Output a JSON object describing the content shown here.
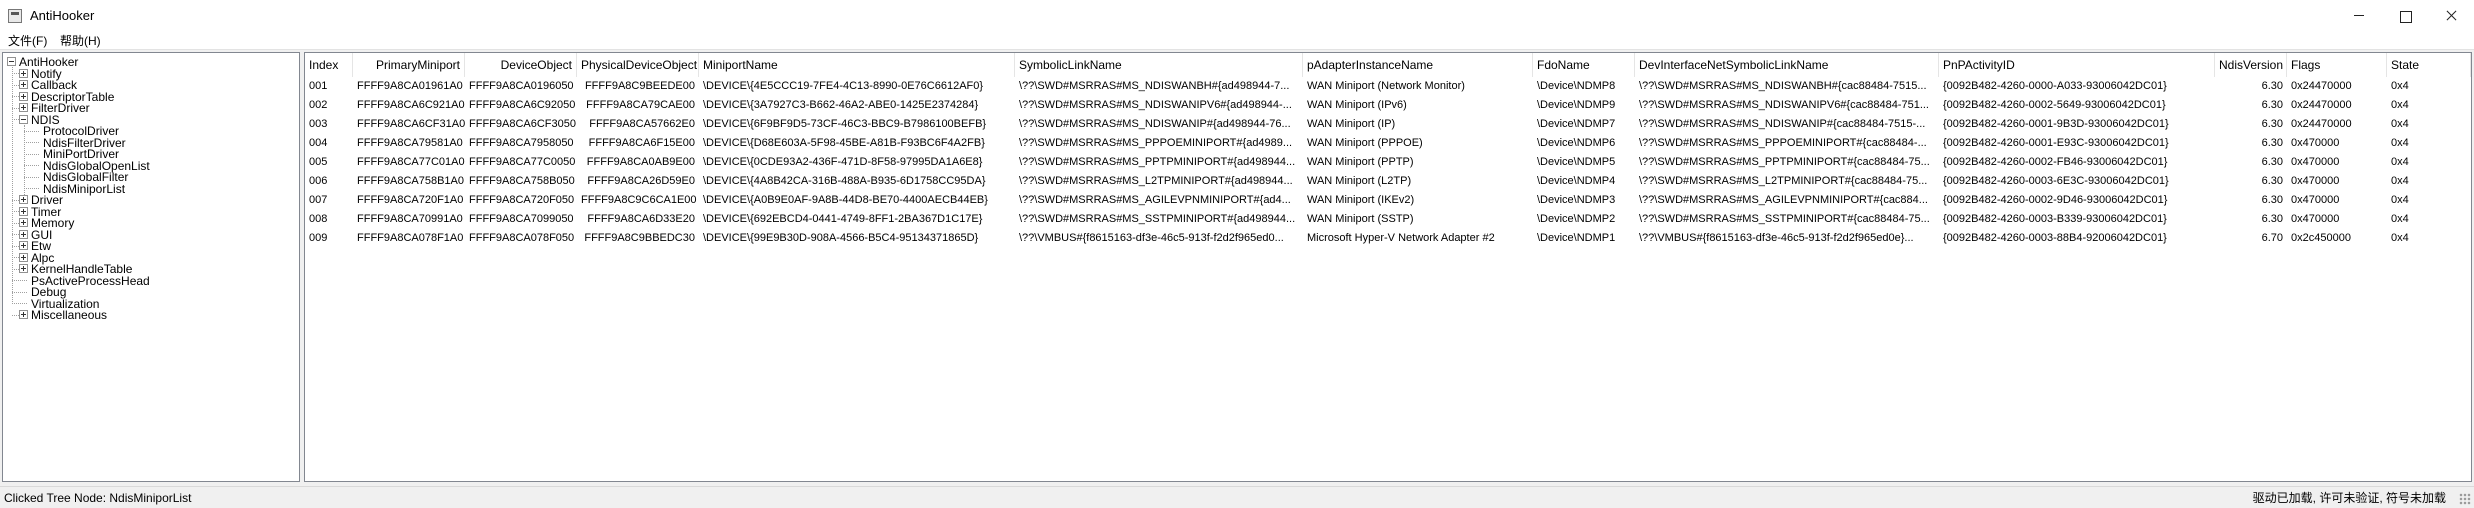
{
  "window": {
    "title": "AntiHooker"
  },
  "menu": {
    "file": "文件(F)",
    "help": "帮助(H)"
  },
  "tree": {
    "root": "AntiHooker",
    "items": [
      {
        "label": "Notify",
        "expandable": true
      },
      {
        "label": "Callback",
        "expandable": true
      },
      {
        "label": "DescriptorTable",
        "expandable": true
      },
      {
        "label": "FilterDriver",
        "expandable": true
      },
      {
        "label": "NDIS",
        "expandable": true,
        "expanded": true,
        "children": [
          "ProtocolDriver",
          "NdisFilterDriver",
          "MiniPortDriver",
          "NdisGlobalOpenList",
          "NdisGlobalFilter",
          "NdisMiniporList"
        ]
      },
      {
        "label": "Driver",
        "expandable": true
      },
      {
        "label": "Timer",
        "expandable": true
      },
      {
        "label": "Memory",
        "expandable": true
      },
      {
        "label": "GUI",
        "expandable": true
      },
      {
        "label": "Etw",
        "expandable": true
      },
      {
        "label": "Alpc",
        "expandable": true
      },
      {
        "label": "KernelHandleTable",
        "expandable": true
      },
      {
        "label": "PsActiveProcessHead",
        "expandable": false
      },
      {
        "label": "Debug",
        "expandable": false
      },
      {
        "label": "Virtualization",
        "expandable": false
      },
      {
        "label": "Miscellaneous",
        "expandable": true
      }
    ]
  },
  "table": {
    "columns": [
      "Index",
      "PrimaryMiniport",
      "DeviceObject",
      "PhysicalDeviceObject",
      "MiniportName",
      "SymbolicLinkName",
      "pAdapterInstanceName",
      "FdoName",
      "DevInterfaceNetSymbolicLinkName",
      "PnPActivityID",
      "NdisVersion",
      "Flags",
      "State"
    ],
    "rows": [
      [
        "001",
        "FFFF9A8CA01961A0",
        "FFFF9A8CA0196050",
        "FFFF9A8C9BEEDE00",
        "\\DEVICE\\{4E5CCC19-7FE4-4C13-8990-0E76C6612AF0}",
        "\\??\\SWD#MSRRAS#MS_NDISWANBH#{ad498944-7...",
        "WAN Miniport (Network Monitor)",
        "\\Device\\NDMP8",
        "\\??\\SWD#MSRRAS#MS_NDISWANBH#{cac88484-7515...",
        "{0092B482-4260-0000-A033-93006042DC01}",
        "6.30",
        "0x24470000",
        "0x4"
      ],
      [
        "002",
        "FFFF9A8CA6C921A0",
        "FFFF9A8CA6C92050",
        "FFFF9A8CA79CAE00",
        "\\DEVICE\\{3A7927C3-B662-46A2-ABE0-1425E2374284}",
        "\\??\\SWD#MSRRAS#MS_NDISWANIPV6#{ad498944-...",
        "WAN Miniport (IPv6)",
        "\\Device\\NDMP9",
        "\\??\\SWD#MSRRAS#MS_NDISWANIPV6#{cac88484-751...",
        "{0092B482-4260-0002-5649-93006042DC01}",
        "6.30",
        "0x24470000",
        "0x4"
      ],
      [
        "003",
        "FFFF9A8CA6CF31A0",
        "FFFF9A8CA6CF3050",
        "FFFF9A8CA57662E0",
        "\\DEVICE\\{6F9BF9D5-73CF-46C3-BBC9-B7986100BEFB}",
        "\\??\\SWD#MSRRAS#MS_NDISWANIP#{ad498944-76...",
        "WAN Miniport (IP)",
        "\\Device\\NDMP7",
        "\\??\\SWD#MSRRAS#MS_NDISWANIP#{cac88484-7515-...",
        "{0092B482-4260-0001-9B3D-93006042DC01}",
        "6.30",
        "0x24470000",
        "0x4"
      ],
      [
        "004",
        "FFFF9A8CA79581A0",
        "FFFF9A8CA7958050",
        "FFFF9A8CA6F15E00",
        "\\DEVICE\\{D68E603A-5F98-45BE-A81B-F93BC6F4A2FB}",
        "\\??\\SWD#MSRRAS#MS_PPPOEMINIPORT#{ad4989...",
        "WAN Miniport (PPPOE)",
        "\\Device\\NDMP6",
        "\\??\\SWD#MSRRAS#MS_PPPOEMINIPORT#{cac88484-...",
        "{0092B482-4260-0001-E93C-93006042DC01}",
        "6.30",
        "0x470000",
        "0x4"
      ],
      [
        "005",
        "FFFF9A8CA77C01A0",
        "FFFF9A8CA77C0050",
        "FFFF9A8CA0AB9E00",
        "\\DEVICE\\{0CDE93A2-436F-471D-8F58-97995DA1A6E8}",
        "\\??\\SWD#MSRRAS#MS_PPTPMINIPORT#{ad498944...",
        "WAN Miniport (PPTP)",
        "\\Device\\NDMP5",
        "\\??\\SWD#MSRRAS#MS_PPTPMINIPORT#{cac88484-75...",
        "{0092B482-4260-0002-FB46-93006042DC01}",
        "6.30",
        "0x470000",
        "0x4"
      ],
      [
        "006",
        "FFFF9A8CA758B1A0",
        "FFFF9A8CA758B050",
        "FFFF9A8CA26D59E0",
        "\\DEVICE\\{4A8B42CA-316B-488A-B935-6D1758CC95DA}",
        "\\??\\SWD#MSRRAS#MS_L2TPMINIPORT#{ad498944...",
        "WAN Miniport (L2TP)",
        "\\Device\\NDMP4",
        "\\??\\SWD#MSRRAS#MS_L2TPMINIPORT#{cac88484-75...",
        "{0092B482-4260-0003-6E3C-93006042DC01}",
        "6.30",
        "0x470000",
        "0x4"
      ],
      [
        "007",
        "FFFF9A8CA720F1A0",
        "FFFF9A8CA720F050",
        "FFFF9A8C9C6CA1E00",
        "\\DEVICE\\{A0B9E0AF-9A8B-44D8-BE70-4400AECB44EB}",
        "\\??\\SWD#MSRRAS#MS_AGILEVPNMINIPORT#{ad4...",
        "WAN Miniport (IKEv2)",
        "\\Device\\NDMP3",
        "\\??\\SWD#MSRRAS#MS_AGILEVPNMINIPORT#{cac884...",
        "{0092B482-4260-0002-9D46-93006042DC01}",
        "6.30",
        "0x470000",
        "0x4"
      ],
      [
        "008",
        "FFFF9A8CA70991A0",
        "FFFF9A8CA7099050",
        "FFFF9A8CA6D33E20",
        "\\DEVICE\\{692EBCD4-0441-4749-8FF1-2BA367D1C17E}",
        "\\??\\SWD#MSRRAS#MS_SSTPMINIPORT#{ad498944...",
        "WAN Miniport (SSTP)",
        "\\Device\\NDMP2",
        "\\??\\SWD#MSRRAS#MS_SSTPMINIPORT#{cac88484-75...",
        "{0092B482-4260-0003-B339-93006042DC01}",
        "6.30",
        "0x470000",
        "0x4"
      ],
      [
        "009",
        "FFFF9A8CA078F1A0",
        "FFFF9A8CA078F050",
        "FFFF9A8C9BBEDC30",
        "\\DEVICE\\{99E9B30D-908A-4566-B5C4-95134371865D}",
        "\\??\\VMBUS#{f8615163-df3e-46c5-913f-f2d2f965ed0...",
        "Microsoft Hyper-V Network Adapter #2",
        "\\Device\\NDMP1",
        "\\??\\VMBUS#{f8615163-df3e-46c5-913f-f2d2f965ed0e}...",
        "{0092B482-4260-0003-88B4-92006042DC01}",
        "6.70",
        "0x2c450000",
        "0x4"
      ]
    ]
  },
  "status": {
    "left": "Clicked Tree Node: NdisMiniporList",
    "right": "驱动已加载, 许可未验证, 符号未加载"
  }
}
